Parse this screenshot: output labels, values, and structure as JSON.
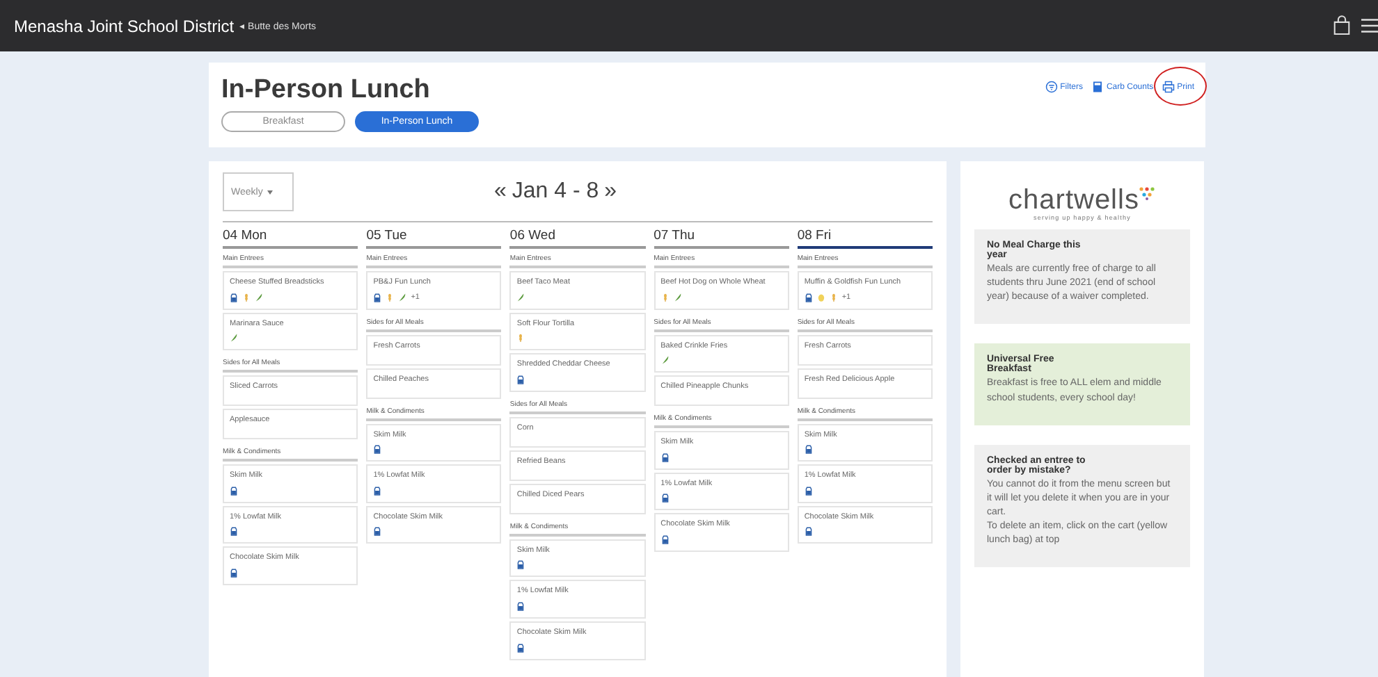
{
  "top_bar": {
    "title": "Menasha Joint School District",
    "school": "◂ Butte des Morts"
  },
  "header": {
    "title": "In-Person Lunch",
    "tabs": [
      {
        "label": "Breakfast",
        "selected": false
      },
      {
        "label": "In-Person Lunch",
        "selected": true
      }
    ],
    "actions": [
      {
        "kind": "filter",
        "label": "Filters",
        "circled": false
      },
      {
        "kind": "calc",
        "label": "Carb Counts",
        "circled": false
      },
      {
        "kind": "print",
        "label": "Print",
        "circled": true
      }
    ]
  },
  "calendar": {
    "view": "Weekly",
    "prev": "«",
    "range": "Jan 4 - 8",
    "next": "»",
    "days": [
      {
        "label": "04 Mon",
        "selected": false,
        "sections": [
          {
            "title": "Main Entrees",
            "items": [
              {
                "name": "Cheese Stuffed Breadsticks",
                "icons": [
                  {
                    "kind": "milk"
                  },
                  {
                    "kind": "grain"
                  },
                  {
                    "kind": "veg"
                  }
                ]
              },
              {
                "name": "Marinara Sauce",
                "icons": [
                  {
                    "kind": "veg"
                  }
                ]
              }
            ]
          },
          {
            "title": "Sides for All Meals",
            "items": [
              {
                "name": "Sliced Carrots"
              },
              {
                "name": "Applesauce"
              }
            ]
          },
          {
            "title": "Milk & Condiments",
            "items": [
              {
                "name": "Skim Milk",
                "icons": [
                  {
                    "kind": "milk"
                  }
                ]
              },
              {
                "name": "1% Lowfat Milk",
                "icons": [
                  {
                    "kind": "milk"
                  }
                ]
              },
              {
                "name": "Chocolate Skim Milk",
                "icons": [
                  {
                    "kind": "milk"
                  }
                ]
              }
            ]
          }
        ]
      },
      {
        "label": "05 Tue",
        "selected": false,
        "sections": [
          {
            "title": "Main Entrees",
            "items": [
              {
                "name": "PB&J Fun Lunch",
                "icons": [
                  {
                    "kind": "milk"
                  },
                  {
                    "kind": "grain"
                  },
                  {
                    "kind": "veg"
                  }
                ],
                "more": "+1"
              }
            ]
          },
          {
            "title": "Sides for All Meals",
            "items": [
              {
                "name": "Fresh Carrots"
              },
              {
                "name": "Chilled Peaches"
              }
            ]
          },
          {
            "title": "Milk & Condiments",
            "items": [
              {
                "name": "Skim Milk",
                "icons": [
                  {
                    "kind": "milk"
                  }
                ]
              },
              {
                "name": "1% Lowfat Milk",
                "icons": [
                  {
                    "kind": "milk"
                  }
                ]
              },
              {
                "name": "Chocolate Skim Milk",
                "icons": [
                  {
                    "kind": "milk"
                  }
                ]
              }
            ]
          }
        ]
      },
      {
        "label": "06 Wed",
        "selected": false,
        "sections": [
          {
            "title": "Main Entrees",
            "items": [
              {
                "name": "Beef Taco Meat",
                "icons": [
                  {
                    "kind": "veg"
                  }
                ]
              },
              {
                "name": "Soft Flour Tortilla",
                "icons": [
                  {
                    "kind": "grain"
                  }
                ]
              },
              {
                "name": "Shredded Cheddar Cheese",
                "icons": [
                  {
                    "kind": "milk"
                  }
                ]
              }
            ]
          },
          {
            "title": "Sides for All Meals",
            "items": [
              {
                "name": "Corn"
              },
              {
                "name": "Refried Beans"
              },
              {
                "name": "Chilled Diced Pears"
              }
            ]
          },
          {
            "title": "Milk & Condiments",
            "items": [
              {
                "name": "Skim Milk",
                "icons": [
                  {
                    "kind": "milk"
                  }
                ]
              },
              {
                "name": "1% Lowfat Milk",
                "icons": [
                  {
                    "kind": "milk"
                  }
                ]
              },
              {
                "name": "Chocolate Skim Milk",
                "icons": [
                  {
                    "kind": "milk"
                  }
                ]
              }
            ]
          }
        ]
      },
      {
        "label": "07 Thu",
        "selected": false,
        "sections": [
          {
            "title": "Main Entrees",
            "items": [
              {
                "name": "Beef Hot Dog on Whole Wheat",
                "icons": [
                  {
                    "kind": "grain"
                  },
                  {
                    "kind": "veg"
                  }
                ]
              }
            ]
          },
          {
            "title": "Sides for All Meals",
            "items": [
              {
                "name": "Baked Crinkle Fries",
                "icons": [
                  {
                    "kind": "veg"
                  }
                ]
              },
              {
                "name": "Chilled Pineapple Chunks"
              }
            ]
          },
          {
            "title": "Milk & Condiments",
            "items": [
              {
                "name": "Skim Milk",
                "icons": [
                  {
                    "kind": "milk"
                  }
                ]
              },
              {
                "name": "1% Lowfat Milk",
                "icons": [
                  {
                    "kind": "milk"
                  }
                ]
              },
              {
                "name": "Chocolate Skim Milk",
                "icons": [
                  {
                    "kind": "milk"
                  }
                ]
              }
            ]
          }
        ]
      },
      {
        "label": "08 Fri",
        "selected": true,
        "sections": [
          {
            "title": "Main Entrees",
            "items": [
              {
                "name": "Muffin & Goldfish Fun Lunch",
                "icons": [
                  {
                    "kind": "milk"
                  },
                  {
                    "kind": "egg"
                  },
                  {
                    "kind": "grain"
                  }
                ],
                "more": "+1"
              }
            ]
          },
          {
            "title": "Sides for All Meals",
            "items": [
              {
                "name": "Fresh Carrots"
              },
              {
                "name": "Fresh Red Delicious Apple"
              }
            ]
          },
          {
            "title": "Milk & Condiments",
            "items": [
              {
                "name": "Skim Milk",
                "icons": [
                  {
                    "kind": "milk"
                  }
                ]
              },
              {
                "name": "1% Lowfat Milk",
                "icons": [
                  {
                    "kind": "milk"
                  }
                ]
              },
              {
                "name": "Chocolate Skim Milk",
                "icons": [
                  {
                    "kind": "milk"
                  }
                ]
              }
            ]
          }
        ]
      }
    ]
  },
  "sidebar": {
    "logo": "chartwells",
    "tagline": "serving up happy & healthy",
    "notes": [
      {
        "title": "No Meal Charge this year",
        "body": "Meals are currently free of charge to all students thru June 2021 (end of school year) because of a waiver completed.",
        "color": "#efefef"
      },
      {
        "title": "Universal Free Breakfast",
        "body": "Breakfast is free to ALL elem and middle school students, every school day!",
        "color": "#e4efd9"
      },
      {
        "title": "Checked an entree to order by mistake?",
        "body": "You cannot do it from the menu screen but it will let you delete it when you are in your cart.\nTo delete an item, click on the cart (yellow lunch bag) at top",
        "color": "#efefef"
      }
    ]
  }
}
